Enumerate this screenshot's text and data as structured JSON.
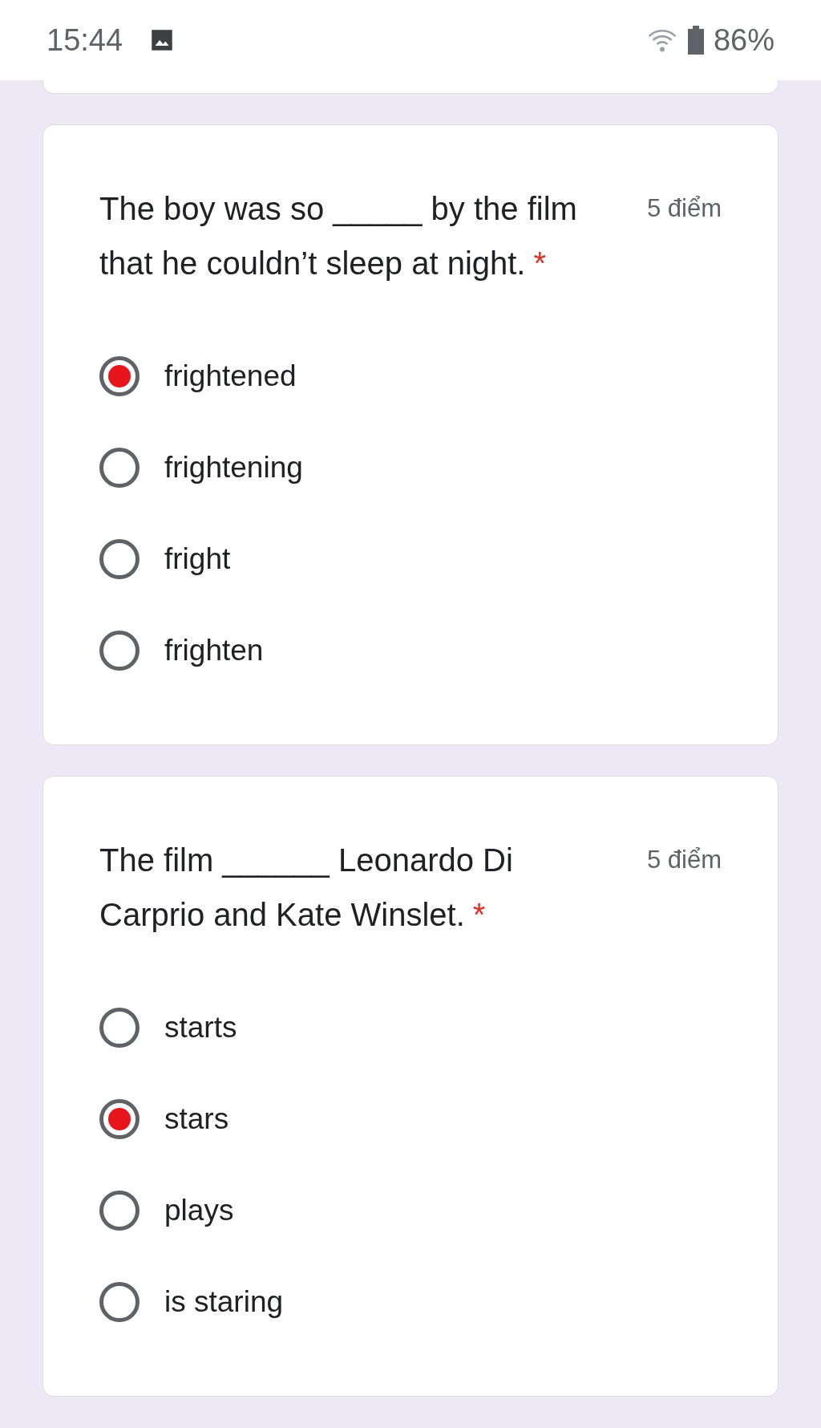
{
  "status_bar": {
    "time": "15:44",
    "battery": "86%"
  },
  "questions": [
    {
      "text": "The boy was so _____ by the film that he couldn’t sleep at night.",
      "required_mark": "*",
      "points": "5 điểm",
      "options": [
        {
          "label": "frightened",
          "selected": true
        },
        {
          "label": "frightening",
          "selected": false
        },
        {
          "label": "fright",
          "selected": false
        },
        {
          "label": "frighten",
          "selected": false
        }
      ]
    },
    {
      "text": "The film ______ Leonardo Di Carprio and Kate Winslet.",
      "required_mark": "*",
      "points": "5 điểm",
      "options": [
        {
          "label": "starts",
          "selected": false
        },
        {
          "label": "stars",
          "selected": true
        },
        {
          "label": "plays",
          "selected": false
        },
        {
          "label": "is staring",
          "selected": false
        }
      ]
    }
  ]
}
